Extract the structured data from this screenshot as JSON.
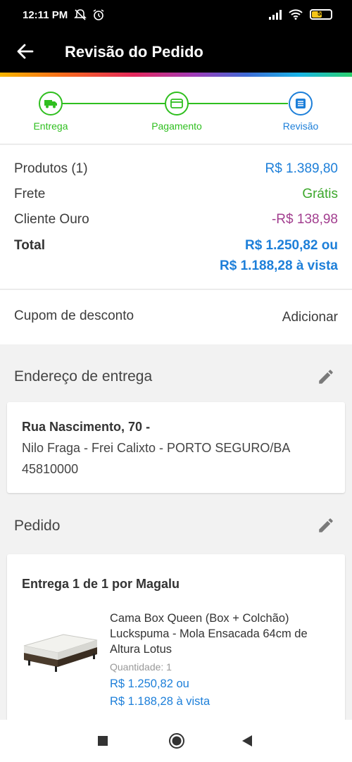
{
  "status_bar": {
    "time": "12:11 PM",
    "battery": "55"
  },
  "app_bar": {
    "title": "Revisão do Pedido"
  },
  "steps": [
    {
      "label": "Entrega"
    },
    {
      "label": "Pagamento"
    },
    {
      "label": "Revisão"
    }
  ],
  "summary": {
    "products_label": "Produtos (1)",
    "products_value": "R$ 1.389,80",
    "shipping_label": "Frete",
    "shipping_value": "Grátis",
    "gold_label": "Cliente Ouro",
    "gold_value": "-R$ 138,98",
    "total_label": "Total",
    "total_value": "R$ 1.250,82 ou",
    "total_cash": "R$ 1.188,28 à vista"
  },
  "coupon": {
    "label": "Cupom de desconto",
    "action": "Adicionar"
  },
  "address_section": {
    "title": "Endereço de entrega",
    "street": "Rua Nascimento, 70 -",
    "district": "Nilo Fraga - Frei Calixto - PORTO SEGURO/BA",
    "zip": "45810000"
  },
  "order_section": {
    "title": "Pedido",
    "delivery": "Entrega 1 de 1 por Magalu",
    "product_name": "Cama Box Queen (Box + Colchão) Luckspuma - Mola Ensacada 64cm de Altura Lotus",
    "quantity": "Quantidade:  1",
    "price": "R$ 1.250,82 ou",
    "price_cash": "R$ 1.188,28 à vista"
  },
  "colors": {
    "green": "#2fbf1f",
    "blue": "#1d7fd9",
    "purple": "#a23e8f"
  }
}
